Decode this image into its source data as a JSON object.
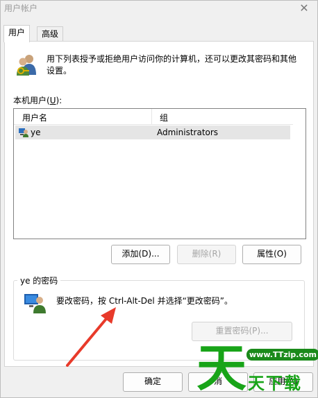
{
  "window": {
    "title": "用户帐户",
    "close_glyph": "✕"
  },
  "tabs": [
    {
      "label": "用户",
      "active": true
    },
    {
      "label": "高级",
      "active": false
    }
  ],
  "info": {
    "text": "用下列表授予或拒绝用户访问你的计算机，还可以更改其密码和其他设置。"
  },
  "users_list": {
    "label_prefix": "本机用户(",
    "label_mnemonic": "U",
    "label_suffix": "):",
    "columns": [
      "用户名",
      "组"
    ],
    "rows": [
      {
        "name": "ye",
        "group": "Administrators"
      }
    ]
  },
  "buttons": {
    "add": "添加(D)...",
    "remove": "删除(R)",
    "properties": "属性(O)"
  },
  "password": {
    "group_title": "ye 的密码",
    "text": "要改密码，按 Ctrl-Alt-Del 并选择“更改密码”。",
    "reset_button": "重置密码(P)..."
  },
  "footer": {
    "ok": "确定",
    "cancel": "消",
    "apply": "应用(A)"
  },
  "watermark": {
    "url": "www.TTzip.com",
    "brand_chars": [
      "天",
      "天",
      "下",
      "载"
    ]
  },
  "colors": {
    "arrow": "#e83a2a",
    "watermark_green": "#18a418"
  }
}
